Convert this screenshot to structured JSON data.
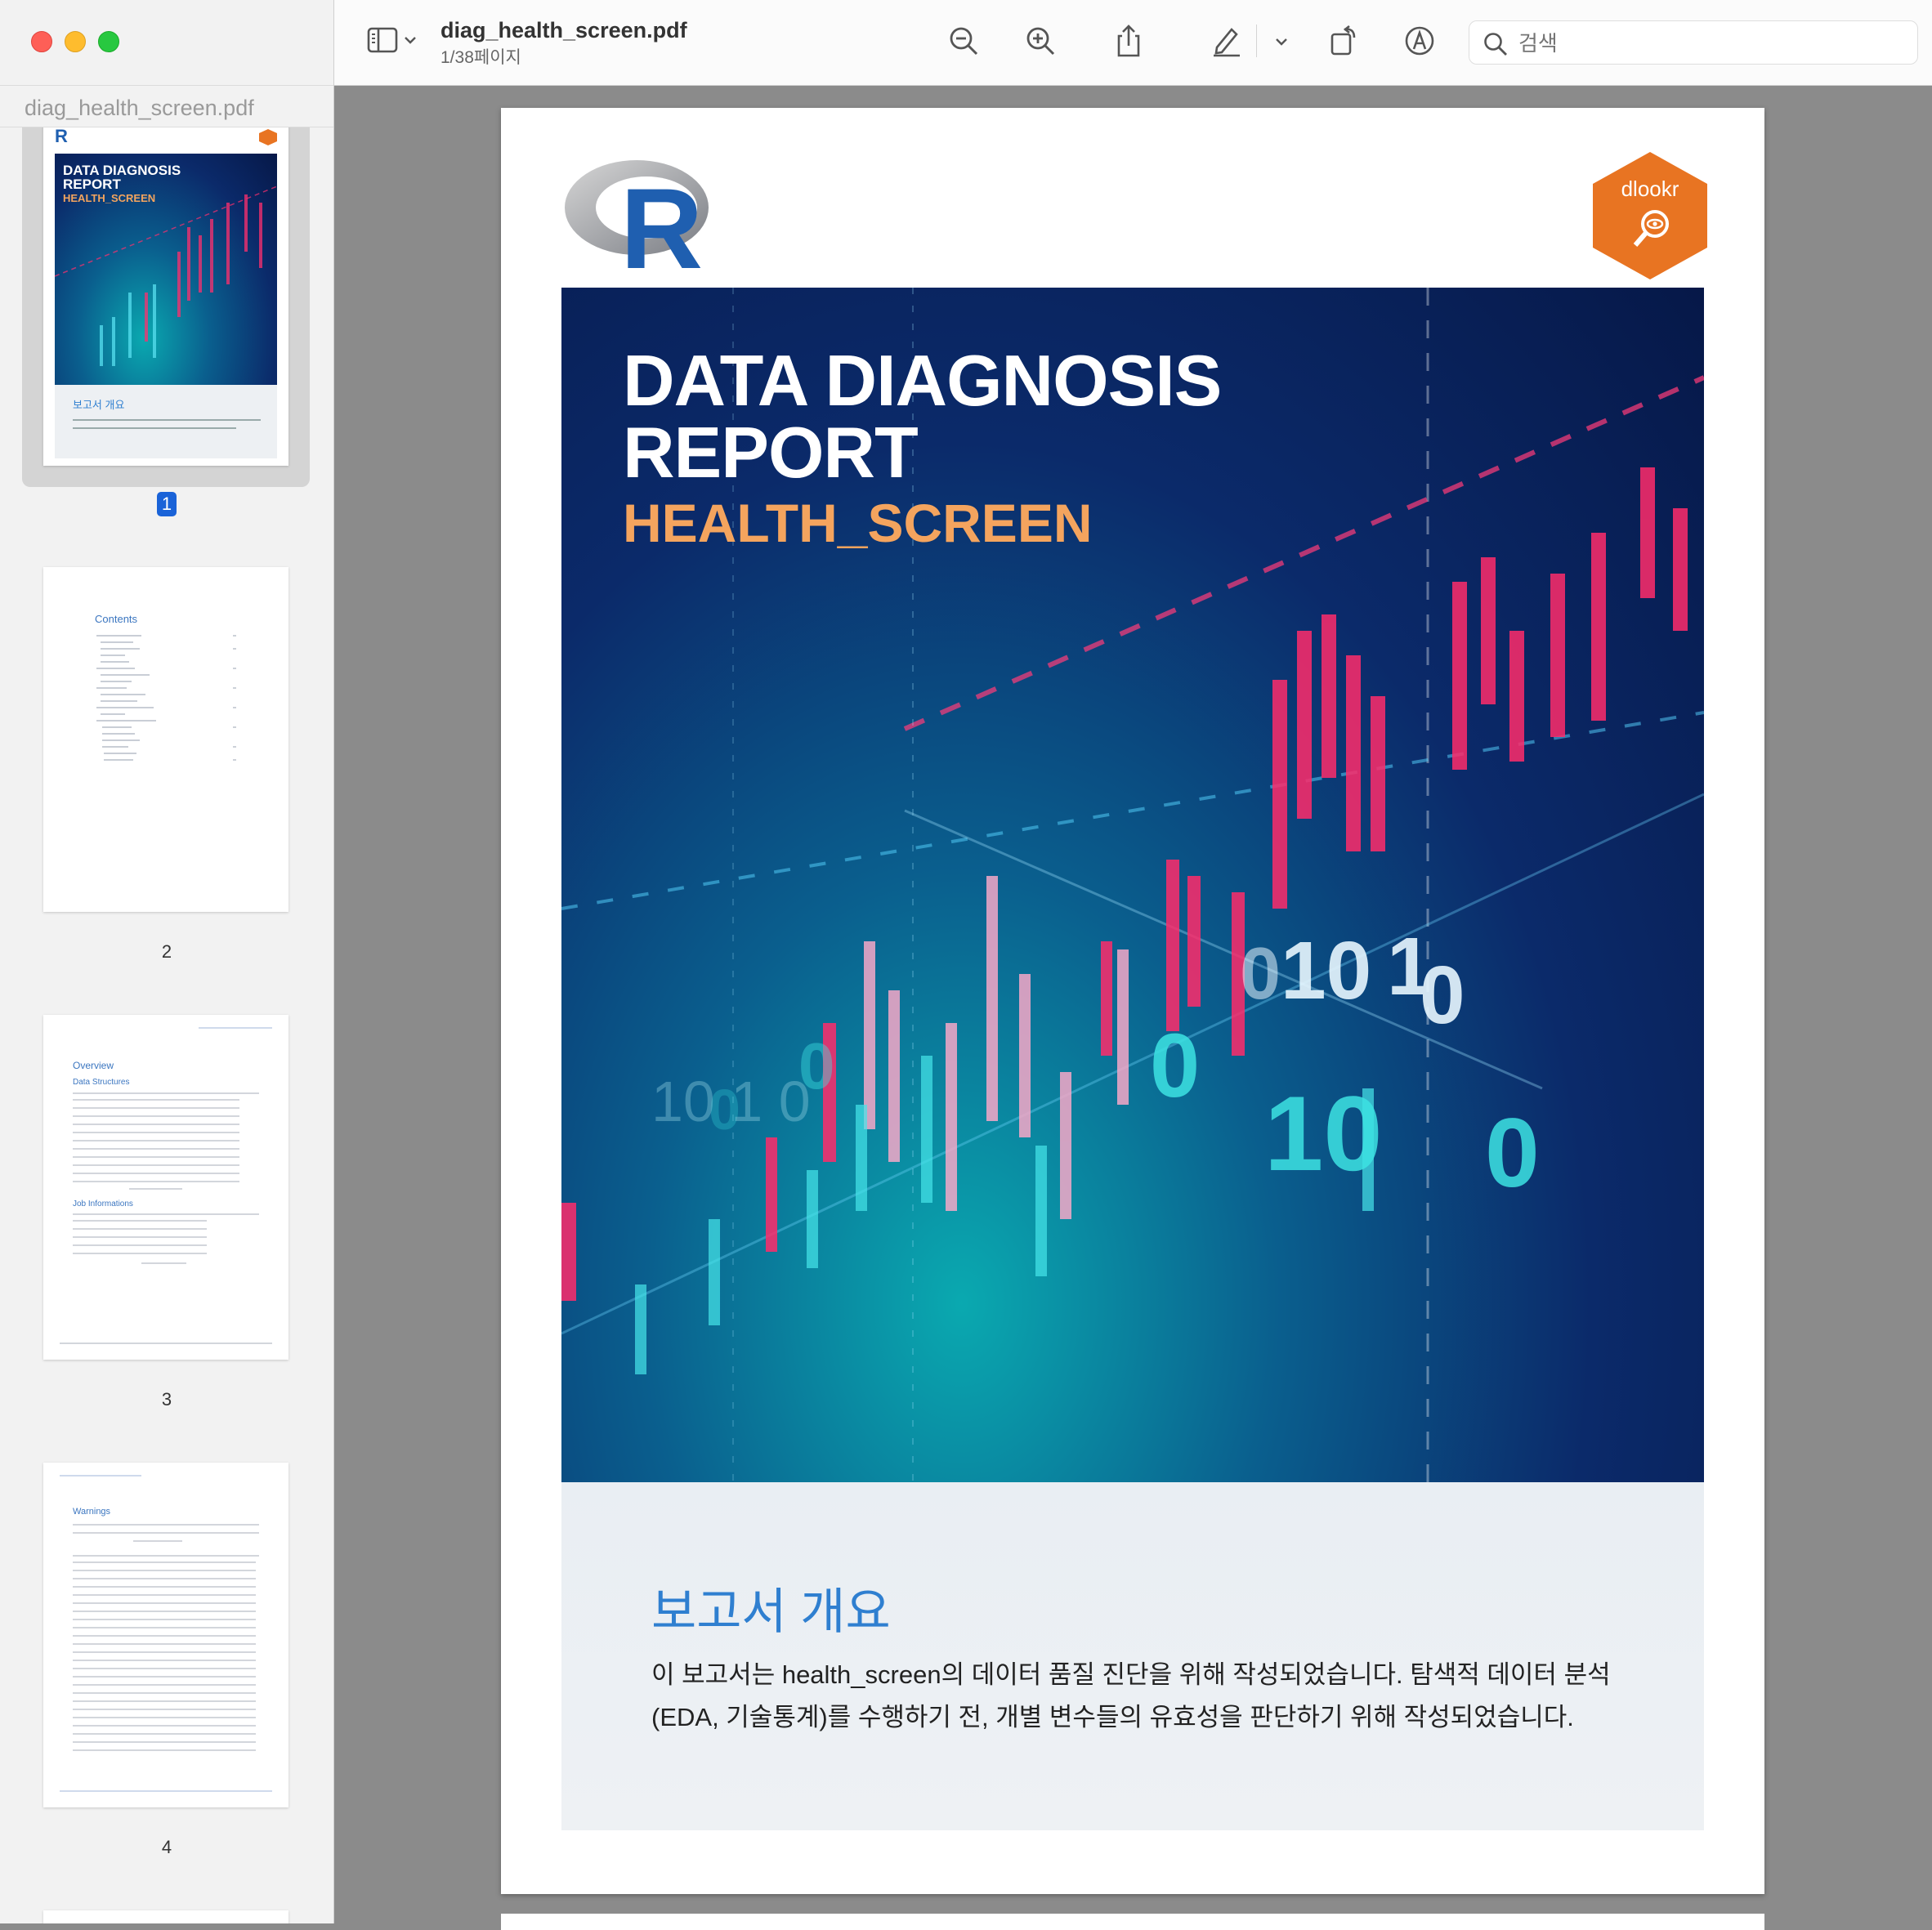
{
  "window": {
    "sidebar_filename": "diag_health_screen.pdf",
    "doc_title": "diag_health_screen.pdf",
    "page_indicator": "1/38페이지"
  },
  "search": {
    "placeholder": "검색"
  },
  "thumbnails": [
    {
      "page": "1",
      "selected": true,
      "title_line1": "DATA DIAGNOSIS",
      "title_line2": "REPORT",
      "subtitle": "HEALTH_SCREEN",
      "overview_title": "보고서 개요"
    },
    {
      "page": "2",
      "heading": "Contents"
    },
    {
      "page": "3",
      "heading": "Overview",
      "section1": "Data Structures",
      "section2": "Job Informations"
    },
    {
      "page": "4",
      "heading": "Warnings"
    }
  ],
  "cover": {
    "title_line1": "DATA DIAGNOSIS",
    "title_line2": "REPORT",
    "subtitle": "HEALTH_SCREEN",
    "r_logo": "R",
    "dlookr_badge": "dlookr",
    "overview_title": "보고서 개요",
    "overview_text": "이 보고서는 health_screen의 데이터 품질 진단을 위해 작성되었습니다. 탐색적 데이터 분석(EDA, 기술통계)를 수행하기 전, 개별 변수들의 유효성을 판단하기 위해 작성되었습니다."
  },
  "colors": {
    "accent_blue": "#2f7fd0",
    "subtitle_orange": "#f4a45e",
    "badge_orange": "#e87422",
    "r_blue": "#1f5fb0",
    "selected_page_badge": "#1a63d8"
  },
  "icons": [
    "sidebar-toggle-icon",
    "chevron-down-icon",
    "zoom-out-icon",
    "zoom-in-icon",
    "share-icon",
    "markup-pen-icon",
    "rotate-icon",
    "annotate-icon",
    "search-icon"
  ]
}
